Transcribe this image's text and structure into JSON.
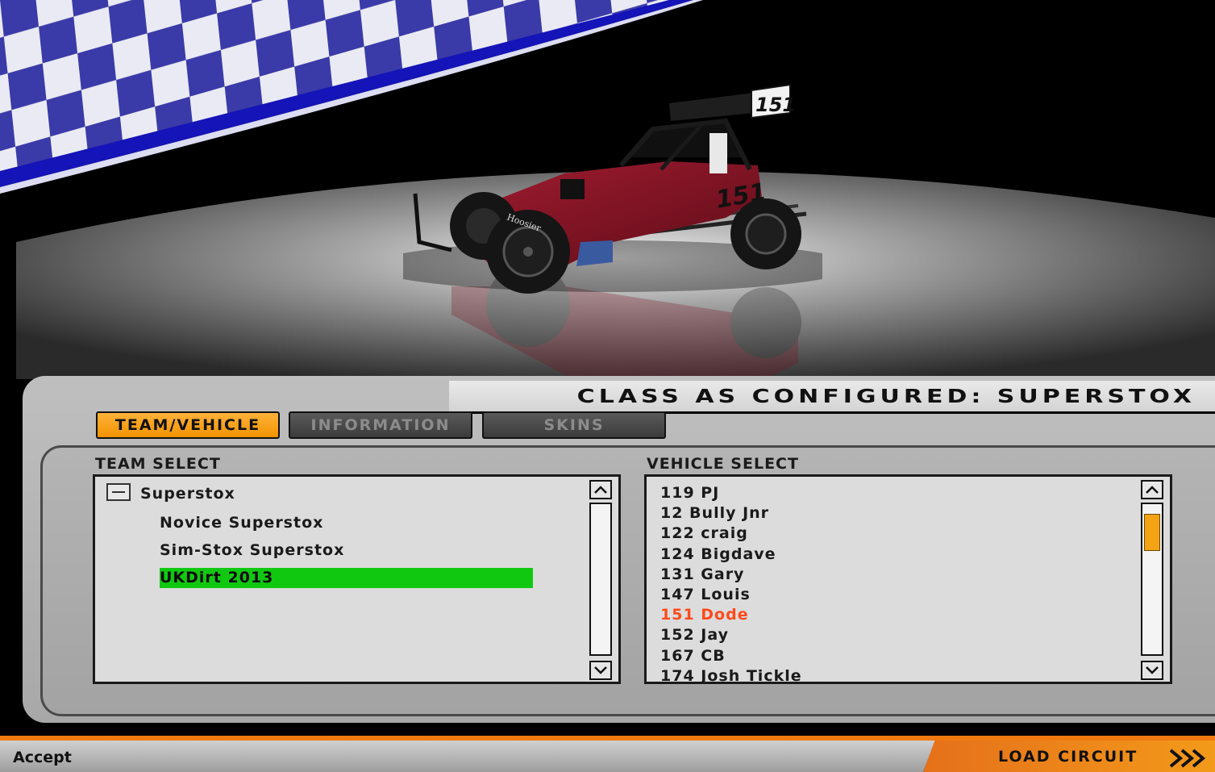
{
  "header": {
    "class_label": "CLASS AS CONFIGURED: SUPERSTOX"
  },
  "car": {
    "number": "151",
    "tire_brand": "Hoosier"
  },
  "tabs": [
    {
      "label": "TEAM/VEHICLE",
      "active": true
    },
    {
      "label": "INFORMATION",
      "active": false
    },
    {
      "label": "SKINS",
      "active": false
    }
  ],
  "team_select": {
    "title": "TEAM SELECT",
    "root": "Superstox",
    "items": [
      "Novice Superstox",
      "Sim-Stox Superstox",
      "UKDirt 2013"
    ],
    "selected": "UKDirt 2013"
  },
  "vehicle_select": {
    "title": "VEHICLE SELECT",
    "items": [
      "119 PJ",
      "12 Bully Jnr",
      "122 craig",
      "124 Bigdave",
      "131 Gary",
      "147 Louis",
      "151 Dode",
      "152 Jay",
      "167 CB",
      "174 Josh Tickle"
    ],
    "selected": "151 Dode"
  },
  "footer": {
    "accept": "Accept",
    "load_circuit": "LOAD CIRCUIT"
  },
  "colors": {
    "tab_active": "#f29300",
    "team_selected": "#11c811",
    "vehicle_selected": "#ff4a1c",
    "checker_blue": "#3a3aa8",
    "car_body": "#7a1020"
  }
}
